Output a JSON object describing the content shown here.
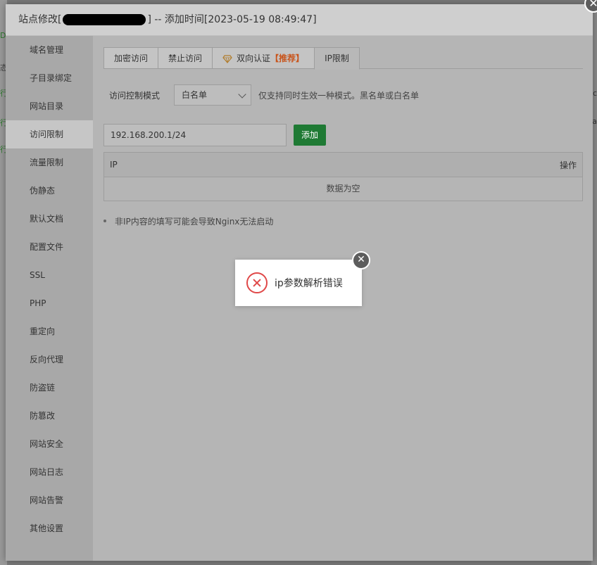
{
  "background": {
    "left_marks": [
      "D",
      "态",
      "行",
      "行",
      "行"
    ],
    "right_marks": [
      "c",
      "a"
    ]
  },
  "dialog": {
    "title_prefix": "站点修改[",
    "title_suffix": "] -- 添加时间[2023-05-19 08:49:47]",
    "close_glyph": "✕"
  },
  "sidebar": {
    "items": [
      {
        "label": "域名管理"
      },
      {
        "label": "子目录绑定"
      },
      {
        "label": "网站目录"
      },
      {
        "label": "访问限制"
      },
      {
        "label": "流量限制"
      },
      {
        "label": "伪静态"
      },
      {
        "label": "默认文档"
      },
      {
        "label": "配置文件"
      },
      {
        "label": "SSL"
      },
      {
        "label": "PHP"
      },
      {
        "label": "重定向"
      },
      {
        "label": "反向代理"
      },
      {
        "label": "防盗链"
      },
      {
        "label": "防篡改"
      },
      {
        "label": "网站安全"
      },
      {
        "label": "网站日志"
      },
      {
        "label": "网站告警"
      },
      {
        "label": "其他设置"
      }
    ],
    "active_index": 3
  },
  "tabs": [
    {
      "label": "加密访问"
    },
    {
      "label": "禁止访问"
    },
    {
      "label": "双向认证",
      "badge": "【推荐】",
      "icon": "diamond-icon"
    },
    {
      "label": "IP限制"
    }
  ],
  "mode": {
    "label": "访问控制模式",
    "selected": "白名单",
    "hint": "仅支持同时生效一种模式。黑名单或白名单"
  },
  "ip_form": {
    "value": "192.168.200.1/24",
    "add_label": "添加"
  },
  "table": {
    "col_ip": "IP",
    "col_action": "操作",
    "empty_text": "数据为空"
  },
  "note": "非IP内容的填写可能会导致Nginx无法启动",
  "toast": {
    "message": "ip参数解析错误",
    "close_glyph": "✕"
  },
  "colors": {
    "add_button": "#1f7a34",
    "recommend": "#c8541b",
    "error": "#e04848"
  }
}
